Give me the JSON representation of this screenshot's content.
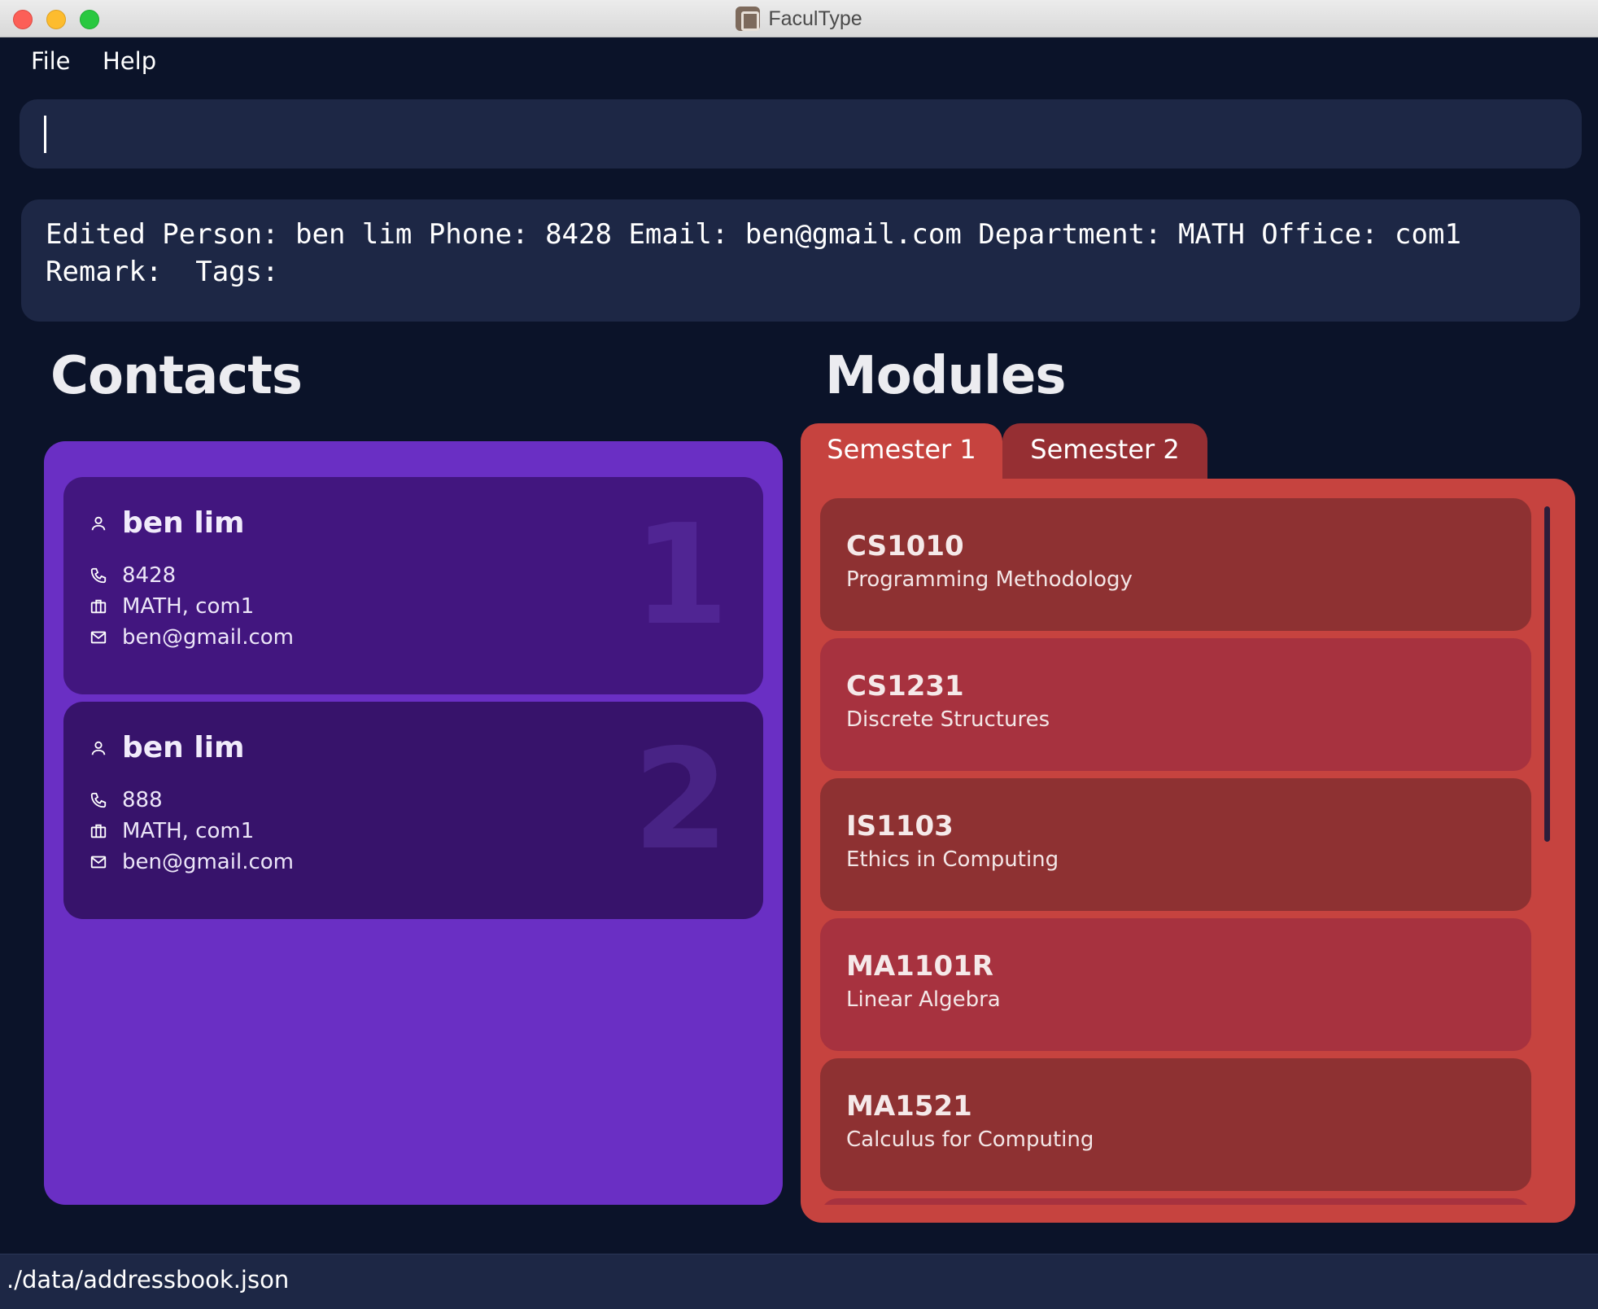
{
  "window": {
    "title": "FaculType"
  },
  "menu": {
    "file": "File",
    "help": "Help"
  },
  "command": {
    "value": ""
  },
  "result": {
    "text": "Edited Person: ben lim Phone: 8428 Email: ben@gmail.com Department: MATH Office: com1\nRemark:  Tags: "
  },
  "contacts": {
    "heading": "Contacts",
    "items": [
      {
        "index": "1",
        "name": "ben lim",
        "phone": "8428",
        "dept_office": "MATH, com1",
        "email": "ben@gmail.com"
      },
      {
        "index": "2",
        "name": "ben lim",
        "phone": "888",
        "dept_office": "MATH, com1",
        "email": "ben@gmail.com"
      }
    ]
  },
  "modules": {
    "heading": "Modules",
    "tabs": [
      {
        "label": "Semester 1",
        "selected": true
      },
      {
        "label": "Semester 2",
        "selected": false
      }
    ],
    "items": [
      {
        "code": "CS1010",
        "name": "Programming Methodology"
      },
      {
        "code": "CS1231",
        "name": "Discrete Structures"
      },
      {
        "code": "IS1103",
        "name": "Ethics in Computing"
      },
      {
        "code": "MA1101R",
        "name": "Linear Algebra"
      },
      {
        "code": "MA1521",
        "name": "Calculus for Computing"
      }
    ]
  },
  "status": {
    "path": "./data/addressbook.json"
  },
  "colors": {
    "background": "#0b1329",
    "panel_dark": "#1d2745",
    "contacts_panel": "#6a2fc4",
    "modules_panel": "#c6433f"
  },
  "icons": {
    "name": "person-icon",
    "phone": "phone-icon",
    "dept": "briefcase-icon",
    "email": "mail-icon"
  }
}
